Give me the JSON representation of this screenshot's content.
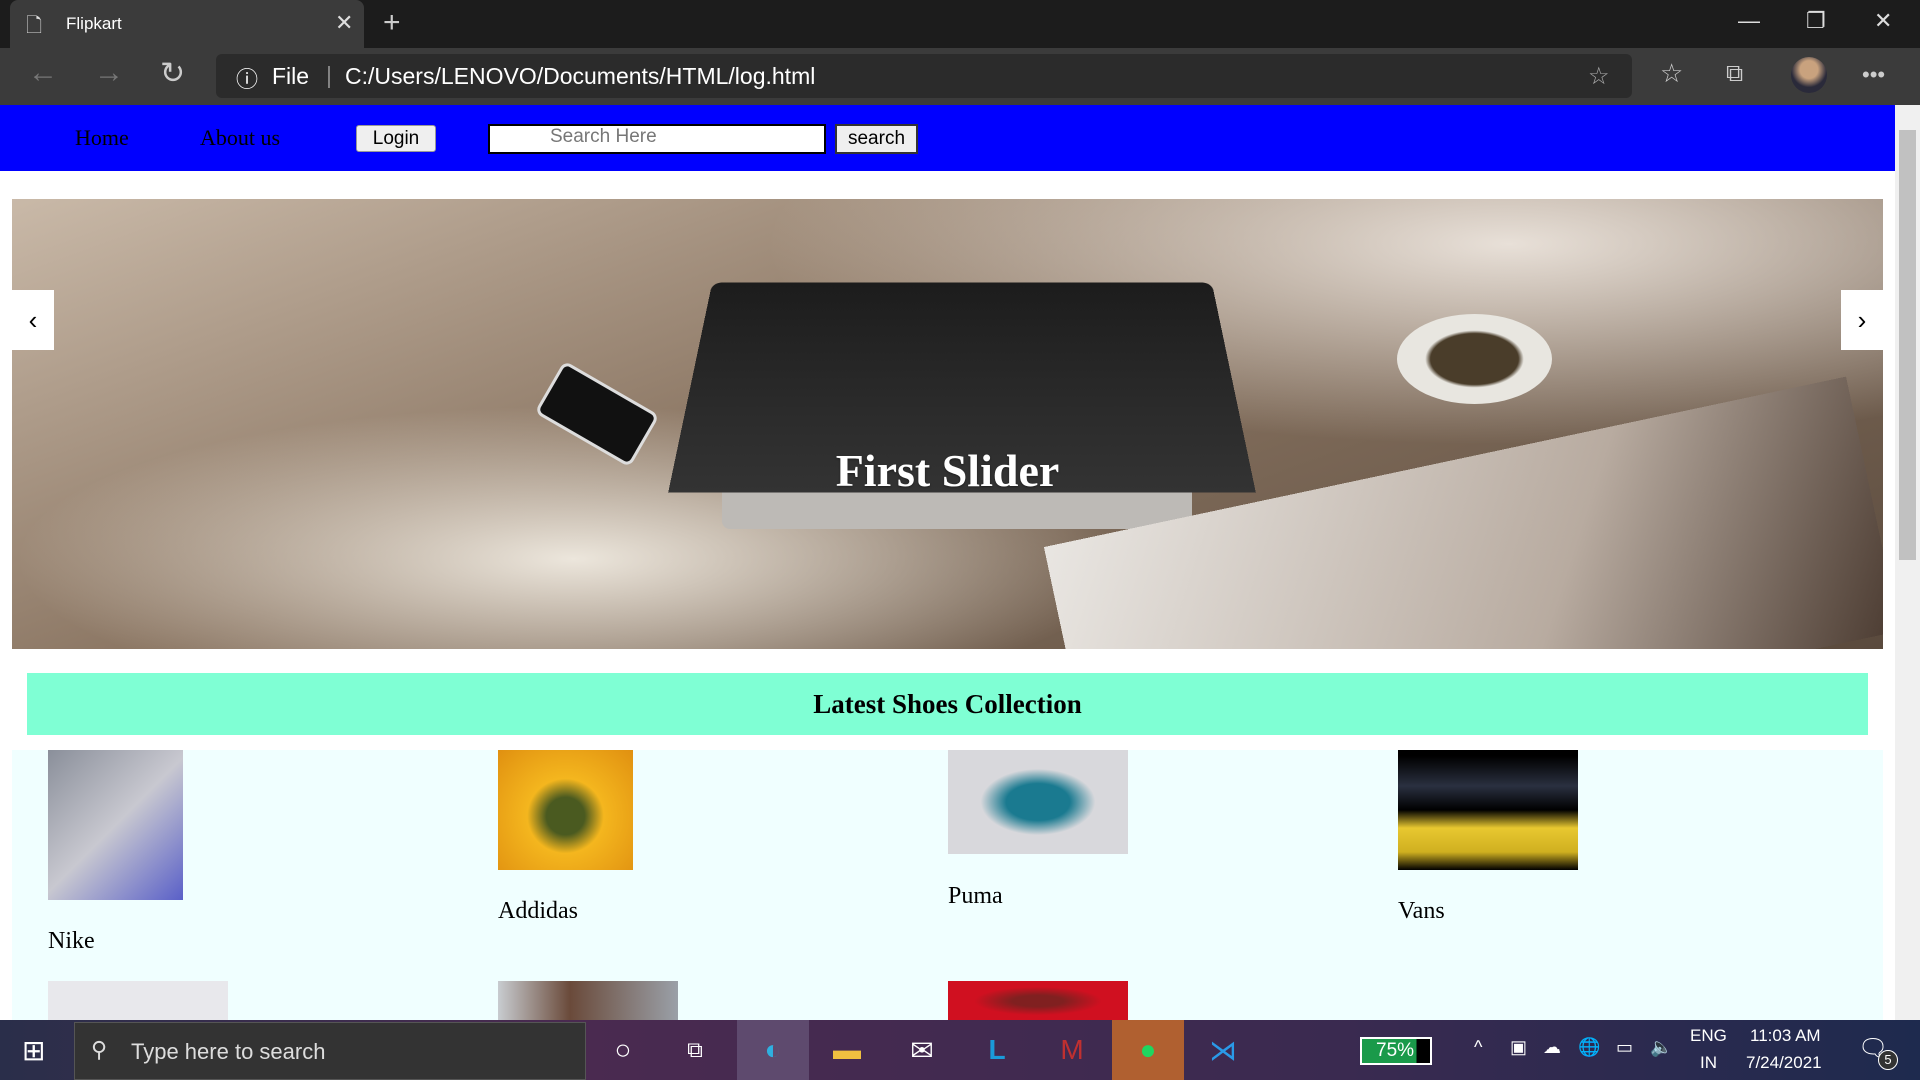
{
  "browser": {
    "tab_title": "Flipkart",
    "address_scheme": "File",
    "address_url": "C:/Users/LENOVO/Documents/HTML/log.html"
  },
  "navbar": {
    "home": "Home",
    "about": "About us",
    "login": "Login",
    "search_placeholder": "Search Here",
    "search_button": "search"
  },
  "slider": {
    "caption": "First Slider",
    "prev": "‹",
    "next": "›"
  },
  "section": {
    "heading": "Latest Shoes Collection"
  },
  "products": [
    {
      "name": "Nike"
    },
    {
      "name": "Addidas"
    },
    {
      "name": "Puma"
    },
    {
      "name": "Vans"
    }
  ],
  "taskbar": {
    "search_placeholder": "Type here to search",
    "battery": "75%",
    "lang": "ENG",
    "region": "IN",
    "time": "11:03 AM",
    "date": "7/24/2021",
    "notifications": "5"
  },
  "colors": {
    "nav": "#0000ff",
    "heading_bg": "#7fffd4",
    "products_bg": "#f0ffff"
  }
}
